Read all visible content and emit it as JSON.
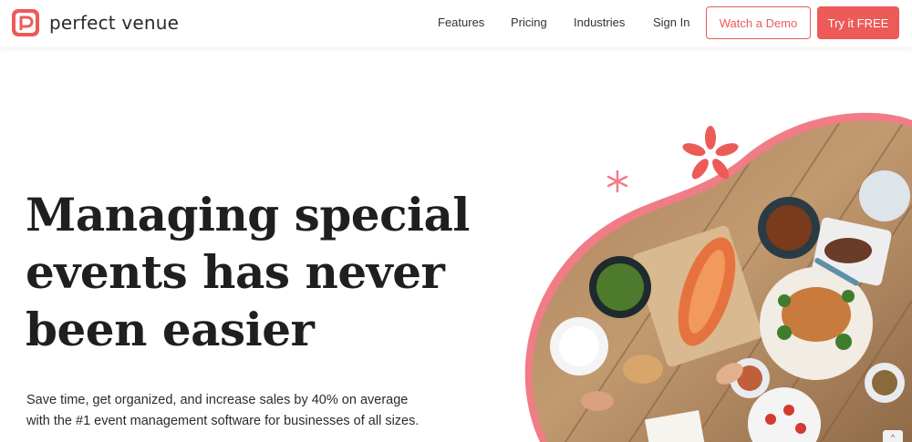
{
  "brand": {
    "name": "perfect venue",
    "accent": "#ec5b58"
  },
  "nav": {
    "items": [
      {
        "label": "Features"
      },
      {
        "label": "Pricing"
      },
      {
        "label": "Industries"
      },
      {
        "label": "Sign In"
      }
    ],
    "demo_label": "Watch a Demo",
    "try_label": "Try it FREE"
  },
  "hero": {
    "headline_lines": [
      "Managing special",
      "events has never",
      "been easier"
    ],
    "subtext_lines": [
      "Save time, get organized, and increase sales by 40% on average",
      "with the #1 event management software for businesses of all sizes."
    ],
    "image_icon": "dinner-table-photo",
    "decor_icons": [
      "asterisk-icon",
      "asterisk-icon"
    ]
  },
  "scroll": {
    "icon": "chevron-up-icon",
    "glyph": "^"
  }
}
